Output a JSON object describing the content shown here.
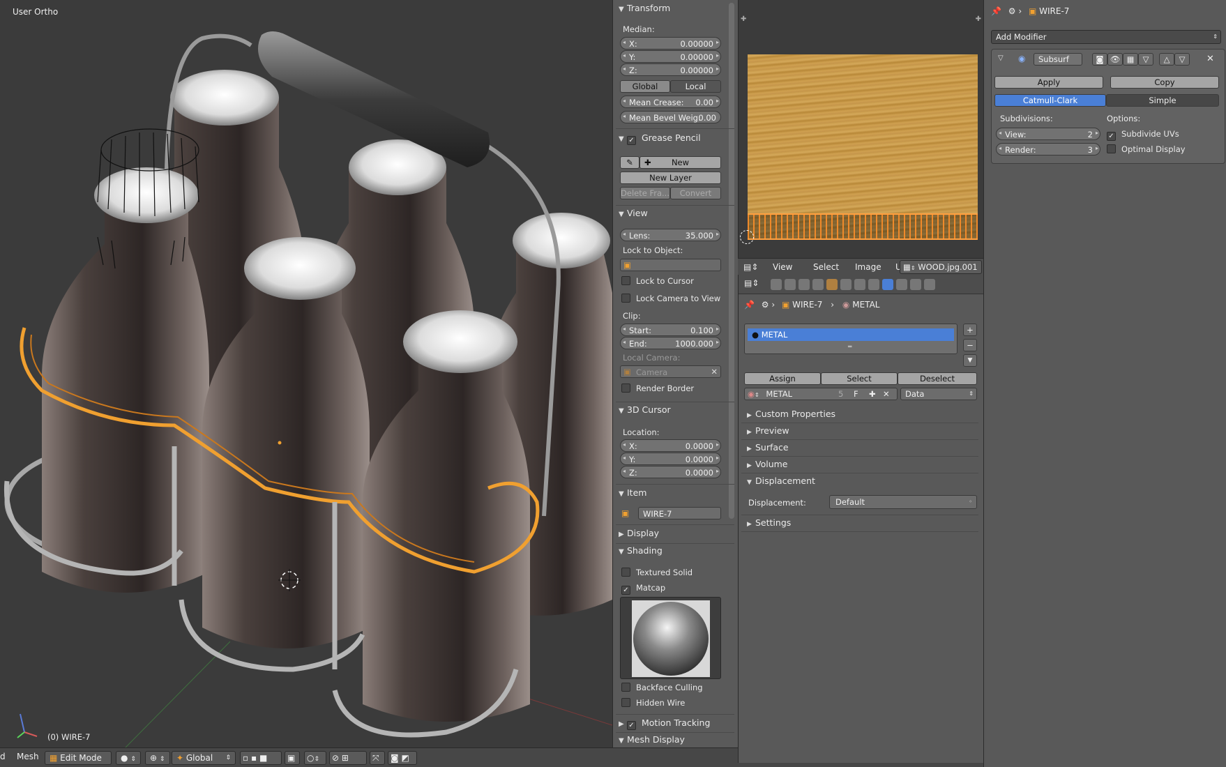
{
  "viewport": {
    "view_name": "User Ortho",
    "object_status": "(0) WIRE-7"
  },
  "viewport_header": {
    "view_menu_partial": "d",
    "mesh_menu": "Mesh",
    "mode": "Edit Mode",
    "orientation": "Global"
  },
  "npanel": {
    "transform": {
      "title": "Transform",
      "median_label": "Median:",
      "x": {
        "label": "X:",
        "value": "0.00000"
      },
      "y": {
        "label": "Y:",
        "value": "0.00000"
      },
      "z": {
        "label": "Z:",
        "value": "0.00000"
      },
      "global_btn": "Global",
      "local_btn": "Local",
      "mean_crease": {
        "label": "Mean Crease:",
        "value": "0.00"
      },
      "mean_bevel": {
        "label": "Mean Bevel Weig:",
        "value": "0.00"
      }
    },
    "grease_pencil": {
      "title": "Grease Pencil",
      "new_btn": "New",
      "new_layer_btn": "New Layer",
      "delete_frame_btn": "Delete Fra...",
      "convert_btn": "Convert"
    },
    "view": {
      "title": "View",
      "lens": {
        "label": "Lens:",
        "value": "35.000"
      },
      "lock_to_object_label": "Lock to Object:",
      "lock_to_cursor": "Lock to Cursor",
      "lock_camera_to_view": "Lock Camera to View",
      "clip_label": "Clip:",
      "clip_start": {
        "label": "Start:",
        "value": "0.100"
      },
      "clip_end": {
        "label": "End:",
        "value": "1000.000"
      },
      "local_camera_label": "Local Camera:",
      "camera_field": "Camera",
      "render_border": "Render Border"
    },
    "cursor": {
      "title": "3D Cursor",
      "location_label": "Location:",
      "x": {
        "label": "X:",
        "value": "0.0000"
      },
      "y": {
        "label": "Y:",
        "value": "0.0000"
      },
      "z": {
        "label": "Z:",
        "value": "0.0000"
      }
    },
    "item": {
      "title": "Item",
      "name": "WIRE-7"
    },
    "display": {
      "title": "Display"
    },
    "shading": {
      "title": "Shading",
      "textured_solid": "Textured Solid",
      "matcap": "Matcap",
      "backface_culling": "Backface Culling",
      "hidden_wire": "Hidden Wire"
    },
    "motion_tracking": {
      "title": "Motion Tracking"
    },
    "mesh_display": {
      "title": "Mesh Display"
    }
  },
  "image_editor": {
    "menu_view": "View",
    "menu_select": "Select",
    "menu_image": "Image",
    "menu_uvs": "UVs",
    "image_name": "WOOD.jpg.001"
  },
  "material": {
    "breadcrumb_object": "WIRE-7",
    "breadcrumb_material": "METAL",
    "slot_name": "METAL",
    "assign_btn": "Assign",
    "select_btn": "Select",
    "deselect_btn": "Deselect",
    "material_name": "METAL",
    "user_count": "5",
    "fake_user": "F",
    "link_type": "Data",
    "sections": {
      "custom_properties": "Custom Properties",
      "preview": "Preview",
      "surface": "Surface",
      "volume": "Volume",
      "displacement": "Displacement",
      "settings": "Settings"
    },
    "displacement_label": "Displacement:",
    "displacement_value": "Default"
  },
  "modifier": {
    "breadcrumb_object": "WIRE-7",
    "add_modifier": "Add Modifier",
    "name": "Subsurf",
    "apply_btn": "Apply",
    "copy_btn": "Copy",
    "catmull_btn": "Catmull-Clark",
    "simple_btn": "Simple",
    "subdivisions_label": "Subdivisions:",
    "options_label": "Options:",
    "view": {
      "label": "View:",
      "value": "2"
    },
    "render": {
      "label": "Render:",
      "value": "3"
    },
    "subdivide_uvs": "Subdivide UVs",
    "optimal_display": "Optimal Display"
  },
  "colors": {
    "accent_blue": "#4a7fd6",
    "selection_orange": "#f0a030",
    "viewport_bg": "#3b3b3b",
    "panel_bg": "#5a5a5a"
  }
}
